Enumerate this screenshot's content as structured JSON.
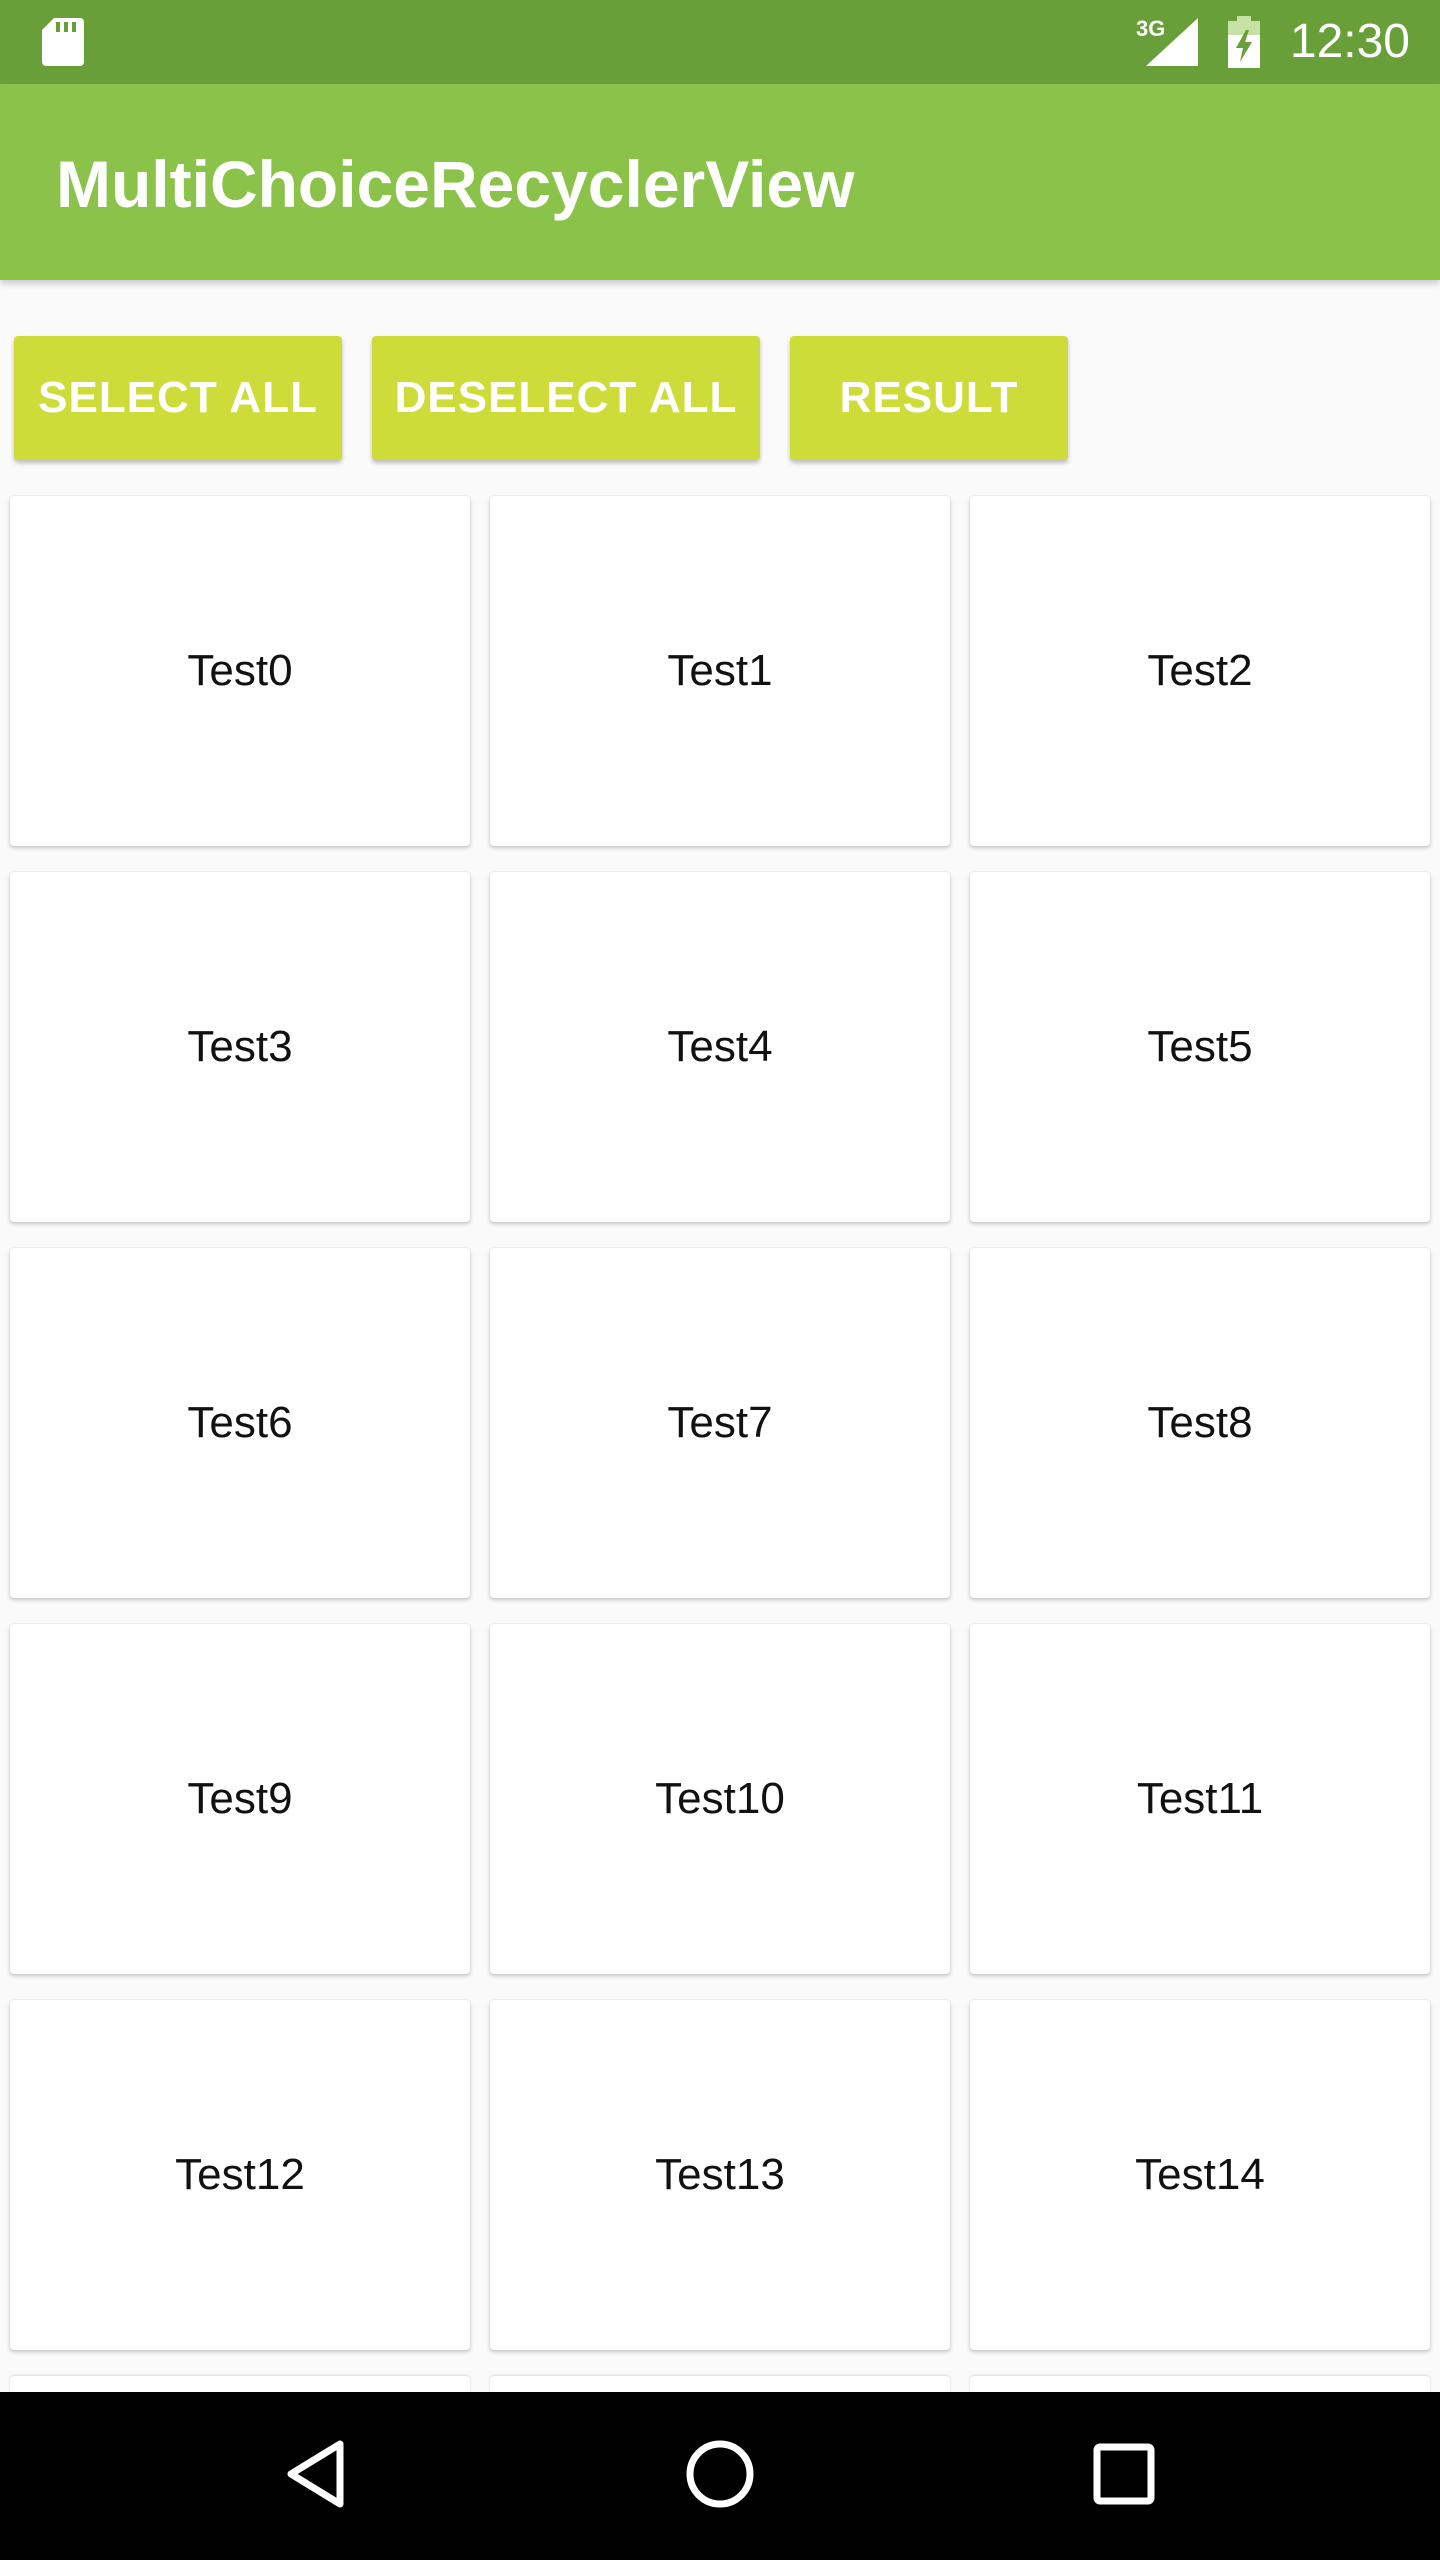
{
  "status_bar": {
    "network": "3G",
    "time": "12:30",
    "icons": [
      "sd-card-icon",
      "signal-icon",
      "battery-charging-icon"
    ]
  },
  "app_bar": {
    "title": "MultiChoiceRecyclerView"
  },
  "actions": {
    "select_all": "SELECT ALL",
    "deselect_all": "DESELECT ALL",
    "result": "RESULT"
  },
  "items": [
    {
      "label": "Test0"
    },
    {
      "label": "Test1"
    },
    {
      "label": "Test2"
    },
    {
      "label": "Test3"
    },
    {
      "label": "Test4"
    },
    {
      "label": "Test5"
    },
    {
      "label": "Test6"
    },
    {
      "label": "Test7"
    },
    {
      "label": "Test8"
    },
    {
      "label": "Test9"
    },
    {
      "label": "Test10"
    },
    {
      "label": "Test11"
    },
    {
      "label": "Test12"
    },
    {
      "label": "Test13"
    },
    {
      "label": "Test14"
    }
  ],
  "navigation": {
    "icons": [
      "back-icon",
      "home-icon",
      "recent-apps-icon"
    ]
  },
  "colors": {
    "status_bar": "#689f38",
    "app_bar": "#8bc34a",
    "button": "#cddc39",
    "background": "#fafafa",
    "card": "#ffffff",
    "nav_bar": "#000000"
  }
}
